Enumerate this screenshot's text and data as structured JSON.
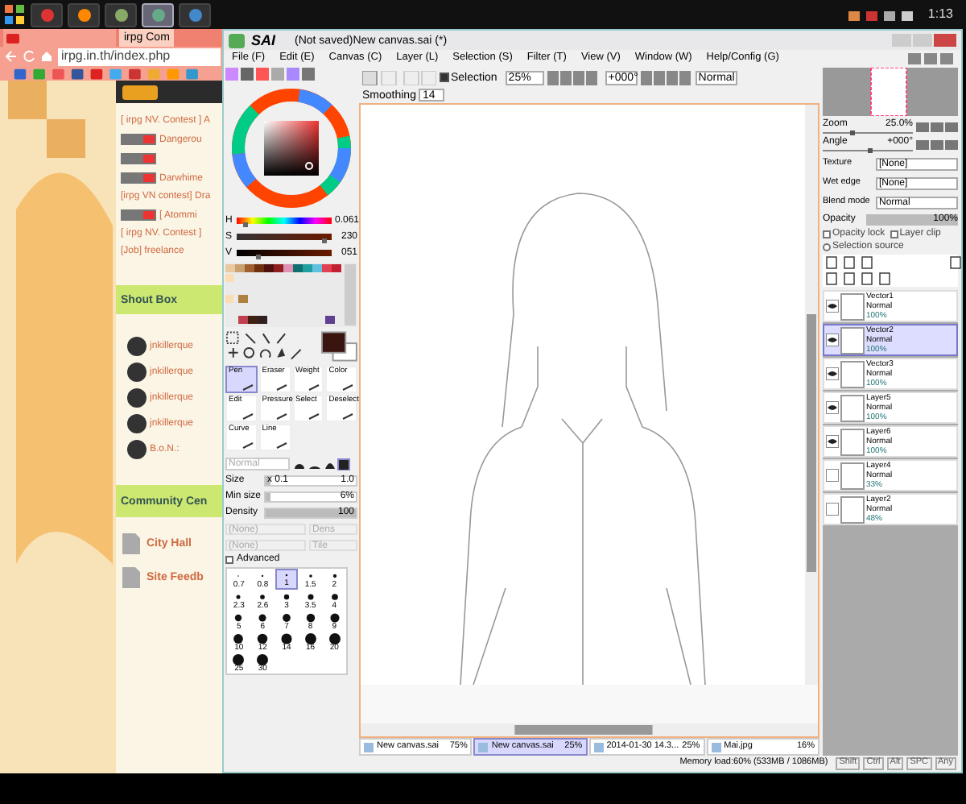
{
  "taskbar": {
    "apps": [
      {
        "selected": false
      },
      {
        "selected": false
      },
      {
        "selected": false
      },
      {
        "selected": true
      },
      {
        "selected": false
      }
    ],
    "clock": "1:13"
  },
  "browser": {
    "tabs": [
      {
        "label": "irpg Com",
        "selected": true
      }
    ],
    "address": "irpg.in.th/index.php",
    "posts": [
      {
        "kind": "text",
        "label": "[ irpg NV. Contest ] A"
      },
      {
        "kind": "badge",
        "label": "Dangerou"
      },
      {
        "kind": "badge"
      },
      {
        "kind": "badge",
        "label": "Darwhime"
      },
      {
        "kind": "text",
        "label": "[irpg VN contest] Dra"
      },
      {
        "kind": "badge",
        "label": "[ Atommi"
      },
      {
        "kind": "text",
        "label": "[ irpg NV. Contest ]"
      },
      {
        "kind": "text",
        "label": "[Job] freelance"
      }
    ],
    "shoutbox": {
      "title": "Shout Box",
      "entries": [
        {
          "user": "jnkillerque"
        },
        {
          "user": "jnkillerque"
        },
        {
          "user": "jnkillerque"
        },
        {
          "user": "jnkillerque"
        },
        {
          "user": "B.o.N.:"
        }
      ]
    },
    "community": {
      "title": "Community Cen",
      "forums": [
        "City Hall",
        "Site Feedb"
      ]
    }
  },
  "sai": {
    "logo": "SAI",
    "title": "(Not saved)New canvas.sai (*)",
    "menu": [
      "File (F)",
      "Edit (E)",
      "Canvas (C)",
      "Layer (L)",
      "Selection (S)",
      "Filter (T)",
      "View (V)",
      "Window (W)",
      "Help/Config (G)"
    ],
    "toolbar": {
      "selection": {
        "label": "Selection",
        "checked": true
      },
      "zoom": "25%",
      "angle": "+000°",
      "mode": "Normal"
    },
    "smoothing": {
      "label": "Smoothing",
      "value": "14"
    },
    "color": {
      "sliders": [
        {
          "label": "H",
          "value": "0.061",
          "level": 0.06
        },
        {
          "label": "S",
          "value": "230",
          "level": 0.9
        },
        {
          "label": "V",
          "value": "051",
          "level": 0.2
        }
      ]
    },
    "tools": [
      {
        "label": "Pen",
        "selected": true
      },
      {
        "label": "Eraser",
        "selected": false
      },
      {
        "label": "Weight",
        "selected": false
      },
      {
        "label": "Color",
        "selected": false
      },
      {
        "label": "Edit",
        "selected": false
      },
      {
        "label": "Pressure",
        "selected": false
      },
      {
        "label": "Select",
        "selected": false
      },
      {
        "label": "Deselect",
        "selected": false
      },
      {
        "label": "Curve",
        "selected": false
      },
      {
        "label": "Line",
        "selected": false
      }
    ],
    "brush": {
      "mode": "Normal",
      "sliders": [
        {
          "label": "Size",
          "prefix": "x 0.1",
          "value": "1.0",
          "level": 0.05
        },
        {
          "label": "Min size",
          "value": "6%",
          "level": 0.06
        },
        {
          "label": "Density",
          "value": "100",
          "level": 1
        }
      ],
      "texture": [
        "(None)",
        "(None)"
      ],
      "texture_side": [
        "Dens",
        "Tile"
      ],
      "advanced": {
        "label": "Advanced",
        "checked": false
      }
    },
    "sizes": [
      {
        "label": "0.7",
        "selected": false
      },
      {
        "label": "0.8",
        "selected": false
      },
      {
        "label": "1",
        "selected": true
      },
      {
        "label": "1.5",
        "selected": false
      },
      {
        "label": "2",
        "selected": false
      },
      {
        "label": "2.3",
        "selected": false
      },
      {
        "label": "2.6",
        "selected": false
      },
      {
        "label": "3",
        "selected": false
      },
      {
        "label": "3.5",
        "selected": false
      },
      {
        "label": "4",
        "selected": false
      },
      {
        "label": "5",
        "selected": false
      },
      {
        "label": "6",
        "selected": false
      },
      {
        "label": "7",
        "selected": false
      },
      {
        "label": "8",
        "selected": false
      },
      {
        "label": "9",
        "selected": false
      },
      {
        "label": "10",
        "selected": false
      },
      {
        "label": "12",
        "selected": false
      },
      {
        "label": "14",
        "selected": false
      },
      {
        "label": "16",
        "selected": false
      },
      {
        "label": "20",
        "selected": false
      },
      {
        "label": "25",
        "selected": false
      },
      {
        "label": "30",
        "selected": false
      }
    ],
    "navigator": [
      {
        "label": "Zoom",
        "value": "25.0%",
        "level": 0.3
      },
      {
        "label": "Angle",
        "value": "+000°",
        "level": 0.5
      }
    ],
    "texture": {
      "label": "Texture",
      "value": "[None]"
    },
    "wet_edge": {
      "label": "Wet edge",
      "value": "[None]"
    },
    "blend": {
      "label": "Blend mode",
      "value": "Normal"
    },
    "opacity": {
      "label": "Opacity",
      "value": "100%",
      "level": 1
    },
    "opacity_lock": {
      "label": "Opacity lock",
      "checked": false
    },
    "layer_clip": {
      "label": "Layer clip",
      "checked": false
    },
    "selection_source": {
      "label": "Selection source",
      "checked": false
    },
    "layers": [
      {
        "name": "Vector1",
        "mode": "Normal",
        "opacity": "100%",
        "visible": true,
        "selected": false
      },
      {
        "name": "Vector2",
        "mode": "Normal",
        "opacity": "100%",
        "visible": true,
        "selected": true
      },
      {
        "name": "Vector3",
        "mode": "Normal",
        "opacity": "100%",
        "visible": true,
        "selected": false
      },
      {
        "name": "Layer5",
        "mode": "Normal",
        "opacity": "100%",
        "visible": true,
        "selected": false
      },
      {
        "name": "Layer6",
        "mode": "Normal",
        "opacity": "100%",
        "visible": true,
        "selected": false
      },
      {
        "name": "Layer4",
        "mode": "Normal",
        "opacity": "33%",
        "visible": false,
        "selected": false
      },
      {
        "name": "Layer2",
        "mode": "Normal",
        "opacity": "48%",
        "visible": false,
        "selected": false
      }
    ],
    "documents": [
      {
        "name": "New canvas.sai",
        "zoom": "75%",
        "selected": false
      },
      {
        "name": "New canvas.sai",
        "zoom": "25%",
        "selected": true
      },
      {
        "name": "2014-01-30 14.3...",
        "zoom": "25%",
        "selected": false
      },
      {
        "name": "Mai.jpg",
        "zoom": "16%",
        "selected": false
      }
    ],
    "status": {
      "memory": "Memory load:60% (533MB / 1086MB)",
      "keys": [
        "Shift",
        "Ctrl",
        "Alt",
        "SPC",
        "Any"
      ]
    }
  }
}
